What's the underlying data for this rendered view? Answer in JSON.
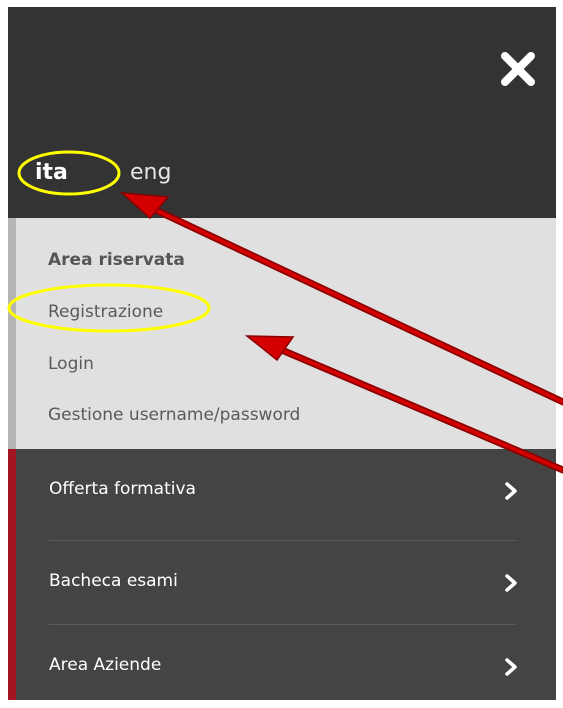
{
  "languages": {
    "ita": "ita",
    "eng": "eng"
  },
  "area_riservata": {
    "title": "Area riservata",
    "links": [
      "Registrazione",
      "Login",
      "Gestione username/password"
    ]
  },
  "menu": {
    "items": [
      {
        "label": "Offerta formativa"
      },
      {
        "label": "Bacheca esami"
      },
      {
        "label": "Area Aziende"
      }
    ]
  },
  "icons": {
    "close": "close-icon",
    "chevron": "chevron-right-icon"
  },
  "colors": {
    "header_bg": "#333333",
    "area_bg": "#e0e0e0",
    "menu_bg": "#444444",
    "menu_accent": "#a31521",
    "annotation_circle": "#ffff00",
    "annotation_arrow": "#c00000"
  }
}
